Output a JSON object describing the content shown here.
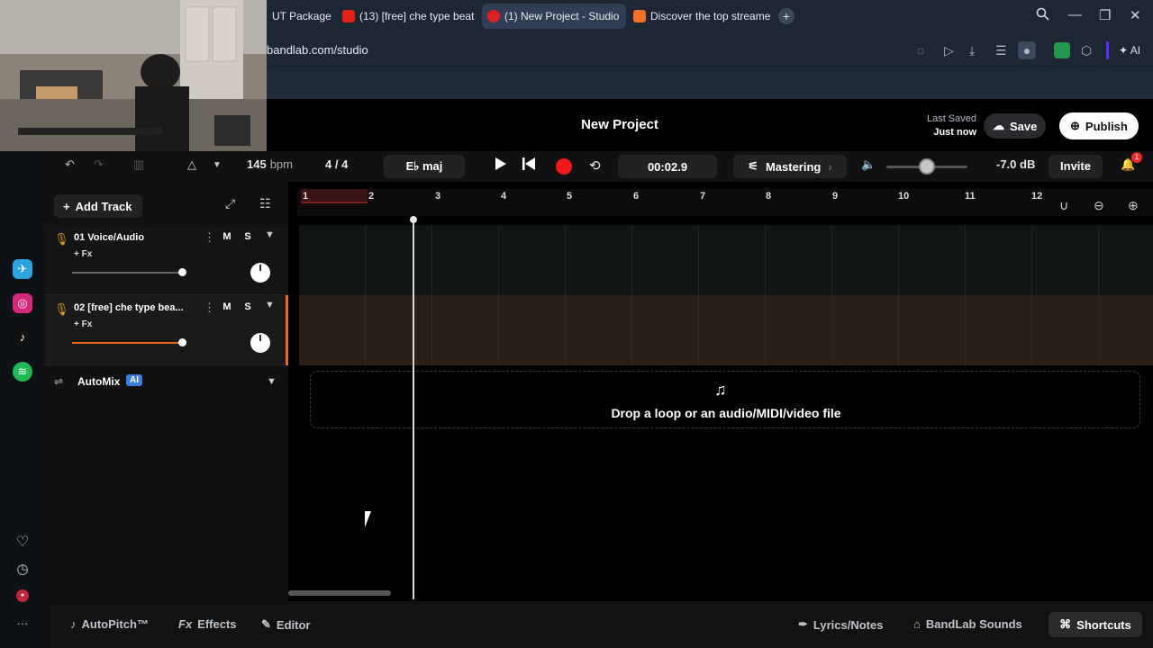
{
  "browser": {
    "tabs": [
      {
        "label": "UT Package"
      },
      {
        "label": "(13) [free] che type beat -"
      },
      {
        "label": "(1) New Project - Studio"
      },
      {
        "label": "Discover the top streamed"
      }
    ],
    "url": "bandlab.com/studio",
    "ai_label": "AI",
    "colors": {
      "tabbar": "#1c2733",
      "active_tab": "#2f3e52"
    }
  },
  "header": {
    "project_title": "New Project",
    "last_saved_label": "Last Saved",
    "last_saved_value": "Just now",
    "save_label": "Save",
    "publish_label": "Publish"
  },
  "transport": {
    "bpm_value": "145",
    "bpm_unit": "bpm",
    "time_signature": "4 / 4",
    "key": "E♭ maj",
    "time": "00:02.9",
    "mastering_label": "Mastering",
    "volume_db": "-7.0 dB",
    "invite_label": "Invite",
    "notification_count": "1"
  },
  "tracks_panel": {
    "add_track_label": "Add Track",
    "tracks": [
      {
        "name": "01  Voice/Audio",
        "fx": "+ Fx",
        "mute": "M",
        "solo": "S"
      },
      {
        "name": "02  [free] che type bea...",
        "fx": "+ Fx",
        "mute": "M",
        "solo": "S"
      }
    ],
    "automix_label": "AutoMix",
    "automix_badge": "AI"
  },
  "timeline": {
    "bars": [
      "1",
      "2",
      "3",
      "4",
      "5",
      "6",
      "7",
      "8",
      "9",
      "10",
      "11",
      "12"
    ],
    "drop_text": "Drop a loop or an audio/MIDI/video file"
  },
  "bottom_bar": {
    "autopitch_label": "AutoPitch™",
    "effects_prefix": "Fx",
    "effects_label": "Effects",
    "editor_label": "Editor",
    "lyrics_label": "Lyrics/Notes",
    "sounds_label": "BandLab Sounds",
    "shortcuts_label": "Shortcuts"
  },
  "colors": {
    "accent_orange": "#e8691c",
    "record_red": "#f01818",
    "ai_badge": "#3d7de0"
  }
}
